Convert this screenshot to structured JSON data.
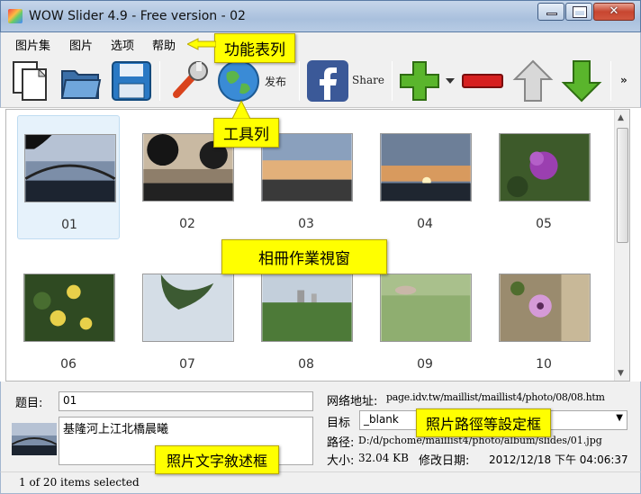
{
  "window": {
    "title": "WOW Slider 4.9 - Free version - 02"
  },
  "menu": [
    "图片集",
    "图片",
    "选项",
    "帮助"
  ],
  "toolbar": {
    "publish_label": "发布",
    "share_label": "Share",
    "overflow": "»"
  },
  "album": {
    "thumbnails": [
      {
        "label": "01",
        "selected": true
      },
      {
        "label": "02",
        "selected": false
      },
      {
        "label": "03",
        "selected": false
      },
      {
        "label": "04",
        "selected": false
      },
      {
        "label": "05",
        "selected": false
      },
      {
        "label": "06",
        "selected": false
      },
      {
        "label": "07",
        "selected": false
      },
      {
        "label": "08",
        "selected": false
      },
      {
        "label": "09",
        "selected": false
      },
      {
        "label": "10",
        "selected": false
      }
    ]
  },
  "details": {
    "title_label": "题目:",
    "title_value": "01",
    "description": "基隆河上江北橋晨曦",
    "url_label": "网络地址:",
    "url_value": "page.idv.tw/maillist/maillist4/photo/08/08.htm",
    "target_label": "目标",
    "target_value": "_blank",
    "path_label": "路径:",
    "path_value": "D:/d/pchome/maillist4/photo/album/slides/01.jpg",
    "size_label": "大小:",
    "size_value": "32.04 KB",
    "modified_label": "修改日期:",
    "modified_value": "2012/12/18 下午 04:06:37"
  },
  "status": {
    "text": "1 of 20 items selected"
  },
  "callouts": {
    "menu": "功能表列",
    "toolbar": "工具列",
    "album": "相冊作業視窗",
    "path": "照片路徑等設定框",
    "text": "照片文字敘述框"
  }
}
